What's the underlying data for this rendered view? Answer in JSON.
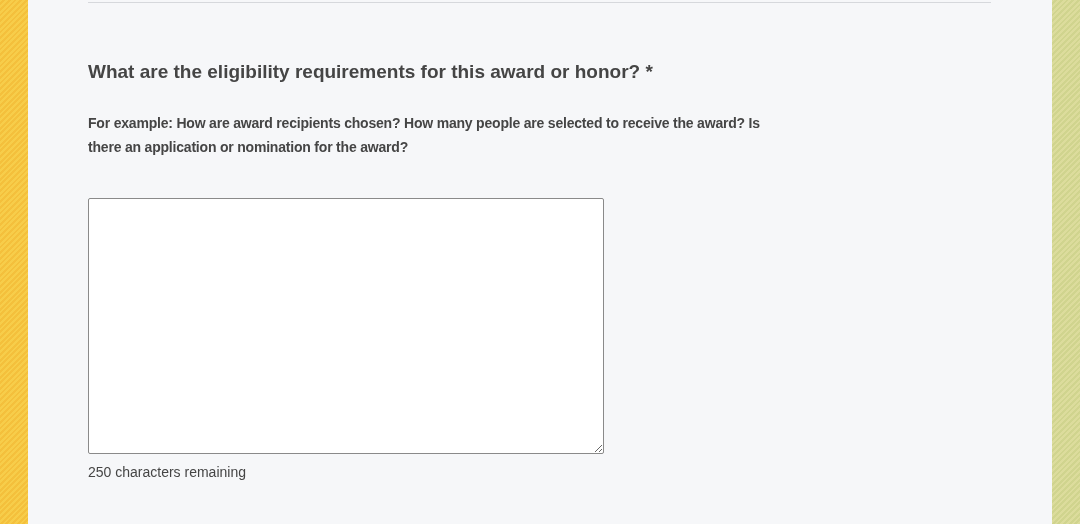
{
  "question": {
    "title": "What are the eligibility requirements for this award or honor? *",
    "help": "For example: How are award recipients chosen? How many people are selected to receive the award? Is there an application or nomination for the award?"
  },
  "answer": {
    "counter": "250 characters remaining"
  }
}
